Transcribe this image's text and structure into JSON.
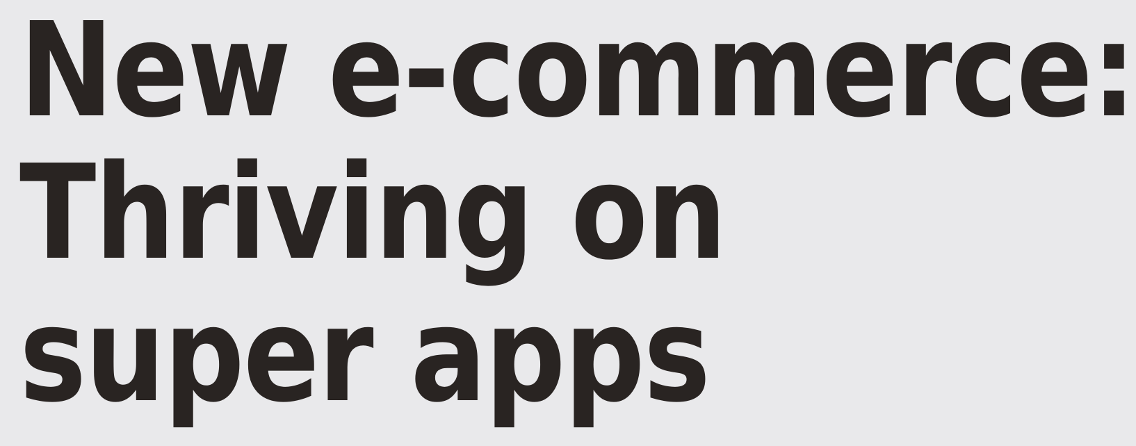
{
  "headline": {
    "lines": [
      "New e-commerce:",
      "Thriving on",
      "super apps"
    ]
  },
  "colors": {
    "background": "#e9e9eb",
    "text": "#292422"
  }
}
